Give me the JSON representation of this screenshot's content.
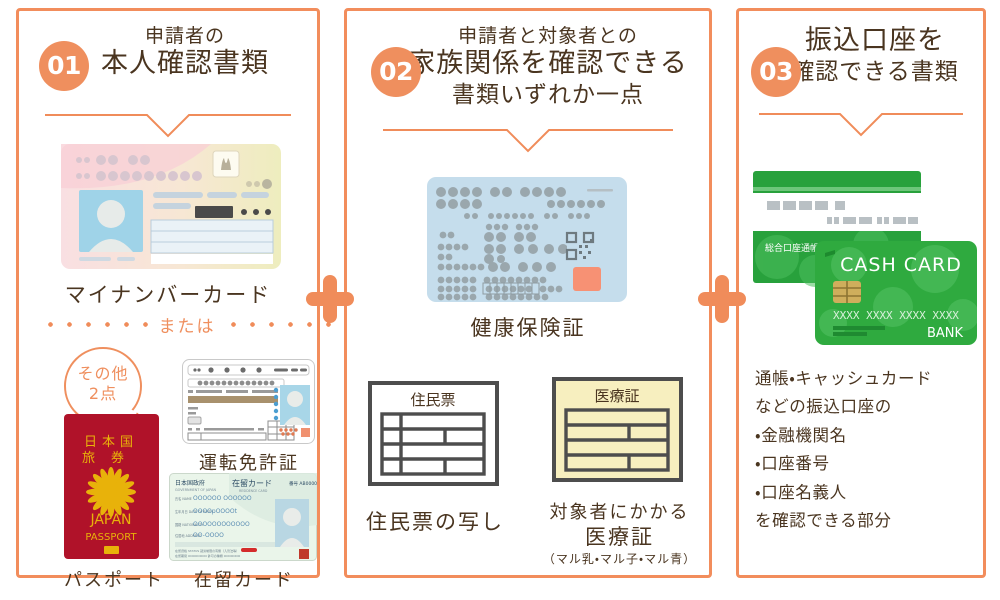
{
  "theme": {
    "accent": "#F28D5C",
    "badge": "#EF8F5E",
    "text": "#4A3520",
    "passport_red": "#B01229",
    "passport_gold": "#E8B20A",
    "bank_green": "#28A13C",
    "insurance_blue": "#C5DDEC",
    "medical_yellow": "#F7EFBF"
  },
  "panels": [
    {
      "number": "01",
      "heading_line1": "申請者の",
      "heading_line2": "本人確認書類",
      "primary": {
        "label": "マイナンバーカード",
        "art": "my-number-card"
      },
      "divider_text": "または",
      "bubble_line1": "その他",
      "bubble_line2": "2点",
      "items": [
        {
          "label": "パスポート",
          "art": "passport",
          "face_text_1": "日本国",
          "face_text_2": "旅券",
          "face_text_3": "JAPAN",
          "face_text_4": "PASSPORT"
        },
        {
          "label": "運転免許証",
          "art": "drivers-license"
        },
        {
          "label": "在留カード",
          "art": "residence-card",
          "card_title": "在留カード",
          "card_issuer": "日本国政府"
        }
      ]
    },
    {
      "number": "02",
      "heading_line1": "申請者と対象者との",
      "heading_line2": "家族関係を確認できる",
      "heading_line3": "書類いずれか一点",
      "primary": {
        "label": "健康保険証",
        "art": "health-insurance-card"
      },
      "items": [
        {
          "label": "住民票の写し",
          "art": "residence-certificate",
          "doc_title": "住民票"
        },
        {
          "label_line1": "対象者にかかる",
          "label_line2": "医療証",
          "label_line3": "（マル乳・マル子・マル青）",
          "art": "medical-certificate",
          "doc_title": "医療証"
        }
      ]
    },
    {
      "number": "03",
      "heading_line1": "振込口座を",
      "heading_line2": "確認できる書類",
      "primary": {
        "art": "bankbook-and-cash-card",
        "bankbook_label": "総合口座通帳",
        "card_title": "CASH CARD",
        "card_number": "XXXX  XXXX  XXXX   XXXX",
        "card_bank": "BANK"
      },
      "notes": [
        "通帳・キャッシュカード",
        "などの振込口座の",
        "・金融機関名",
        "・口座番号",
        "・口座名義人",
        "を確認できる部分"
      ]
    }
  ]
}
